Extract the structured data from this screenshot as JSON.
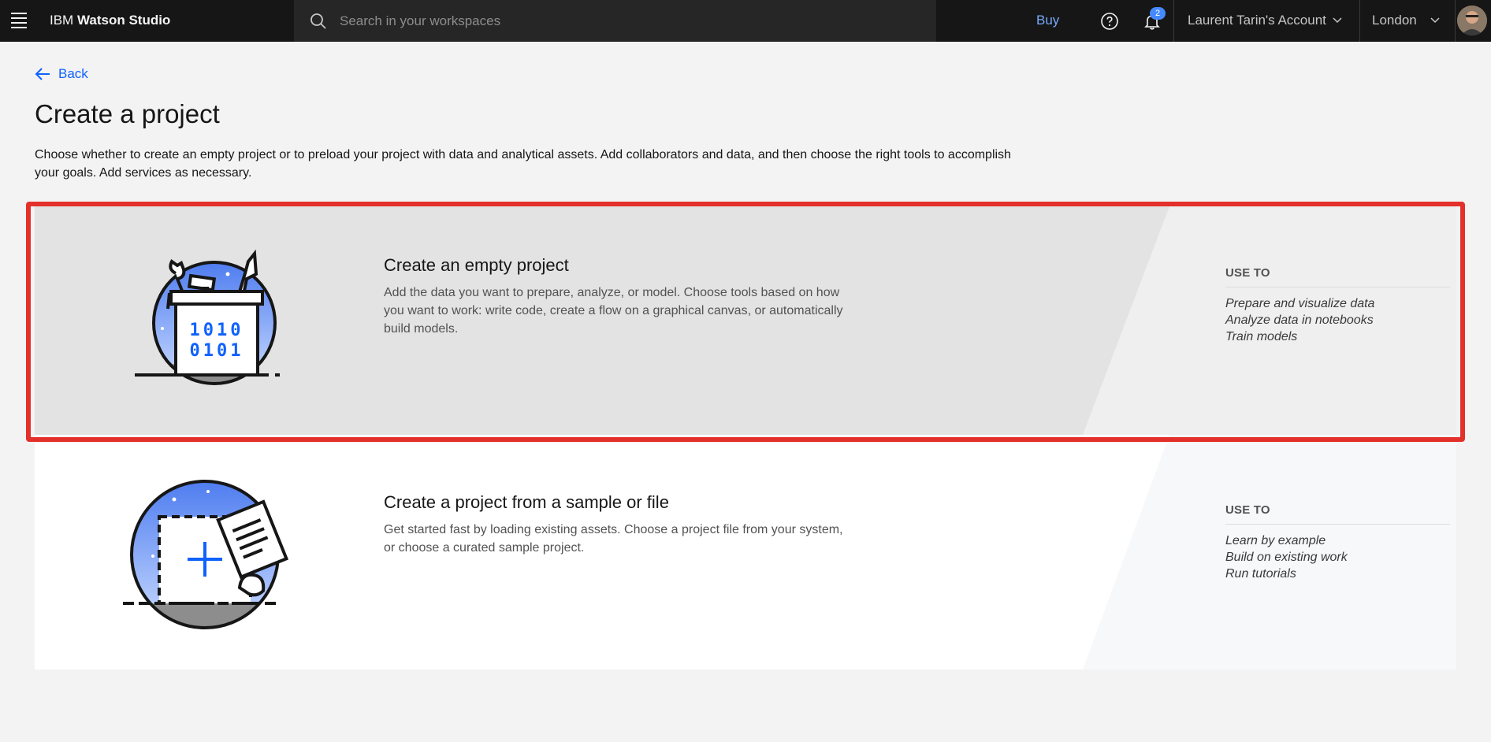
{
  "header": {
    "brand_prefix": "IBM",
    "brand_name": "Watson Studio",
    "search_placeholder": "Search in your workspaces",
    "buy_label": "Buy",
    "notification_count": "2",
    "account_label": "Laurent Tarin's Account",
    "region_label": "London"
  },
  "page": {
    "back_label": "Back",
    "title": "Create a project",
    "intro": "Choose whether to create an empty project or to preload your project with data and analytical assets. Add collaborators and data, and then choose the right tools to accomplish your goals. Add services as necessary."
  },
  "options": [
    {
      "title": "Create an empty project",
      "description": "Add the data you want to prepare, analyze, or model. Choose tools based on how you want to work: write code, create a flow on a graphical canvas, or automatically build models.",
      "use_to_label": "USE TO",
      "uses": [
        "Prepare and visualize data",
        "Analyze data in notebooks",
        "Train models"
      ],
      "art_text_line1": "1010",
      "art_text_line2": "0101"
    },
    {
      "title": "Create a project from a sample or file",
      "description": "Get started fast by loading existing assets. Choose a project file from your system, or choose a curated sample project.",
      "use_to_label": "USE TO",
      "uses": [
        "Learn by example",
        "Build on existing work",
        "Run tutorials"
      ]
    }
  ],
  "colors": {
    "accent_blue": "#0f62fe",
    "highlight_red": "#e3302b",
    "header_bg": "#161616"
  }
}
